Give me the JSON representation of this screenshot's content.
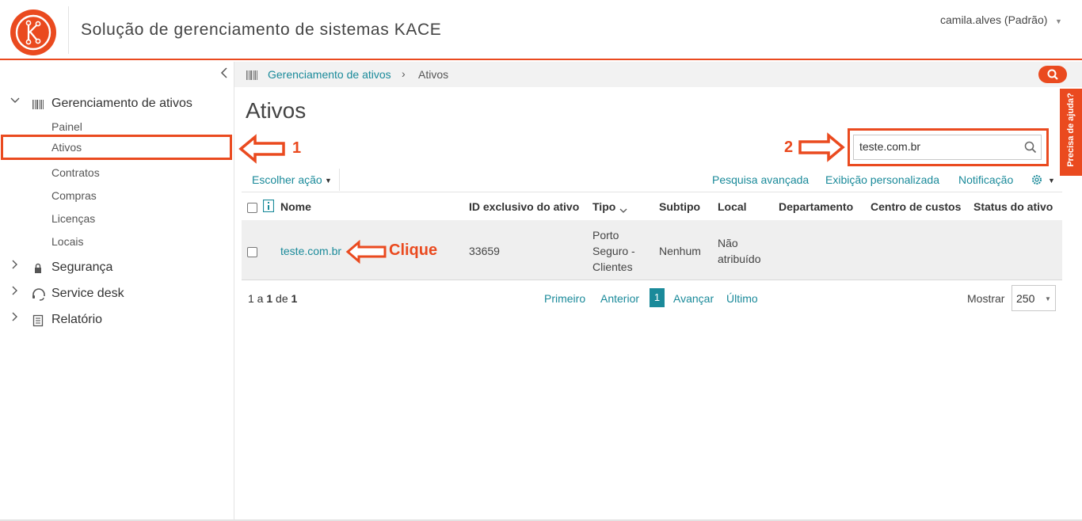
{
  "header": {
    "app_title": "Solução de gerenciamento de sistemas KACE",
    "user": "camila.alves (Padrão)"
  },
  "sidebar": {
    "sections": [
      {
        "label": "Gerenciamento de ativos",
        "icon": "barcode-icon",
        "expanded": true
      },
      {
        "label": "Segurança",
        "icon": "lock-icon",
        "expanded": false
      },
      {
        "label": "Service desk",
        "icon": "headset-icon",
        "expanded": false
      },
      {
        "label": "Relatório",
        "icon": "report-icon",
        "expanded": false
      }
    ],
    "items": [
      "Painel",
      "Ativos",
      "Contratos",
      "Compras",
      "Licenças",
      "Locais"
    ]
  },
  "breadcrumb": {
    "parent": "Gerenciamento de ativos",
    "separator": "›",
    "current": "Ativos"
  },
  "help_tab": "Precisa de ajuda?",
  "page": {
    "title": "Ativos",
    "search_value": "teste.com.br"
  },
  "toolbar": {
    "choose_action": "Escolher ação",
    "advanced_search": "Pesquisa avançada",
    "custom_view": "Exibição personalizada",
    "notification": "Notificação"
  },
  "table": {
    "columns": [
      "Nome",
      "ID exclusivo do ativo",
      "Tipo",
      "Subtipo",
      "Local",
      "Departamento",
      "Centro de custos",
      "Status do ativo"
    ],
    "rows": [
      {
        "name": "teste.com.br",
        "asset_id": "33659",
        "type_lines": [
          "Porto",
          "Seguro -",
          "Clientes"
        ],
        "subtype": "Nenhum",
        "location_lines": [
          "Não",
          "atribuído"
        ],
        "department": "",
        "cost_center": "",
        "status": ""
      }
    ]
  },
  "pager": {
    "info_pre": "1",
    "info_mid1": " a ",
    "info_b2": "1",
    "info_mid2": " de ",
    "info_b3": "1",
    "first": "Primeiro",
    "previous": "Anterior",
    "current": "1",
    "next": "Avançar",
    "last": "Último",
    "show_label": "Mostrar",
    "page_size": "250"
  },
  "annotations": {
    "step1": "1",
    "step2": "2",
    "click": "Clique"
  },
  "colors": {
    "accent": "#ea4a1f",
    "link": "#1a8a9a"
  }
}
